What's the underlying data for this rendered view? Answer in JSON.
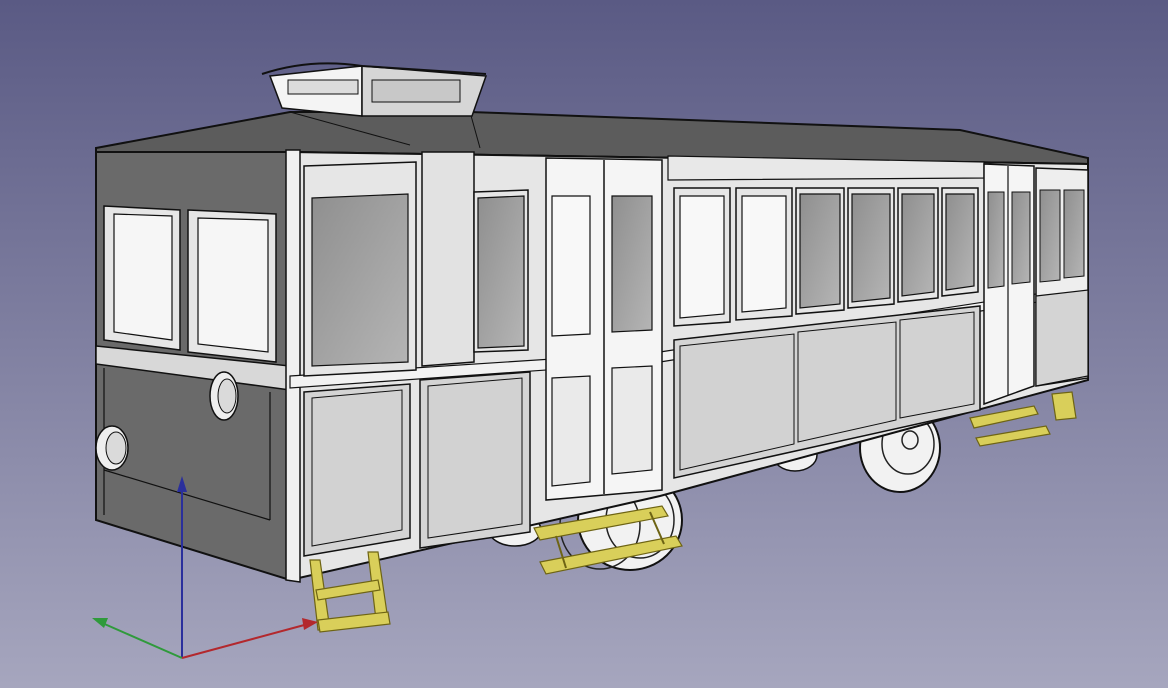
{
  "viewport": {
    "background_top": "#5a5a84",
    "background_bottom": "#a6a6be"
  },
  "model": {
    "body_fill": "#e6e6e6",
    "panel_fill": "#d4d4d4",
    "glass_fill": "#9a9a9a",
    "roof_fill": "#5c5c5c",
    "end_fill": "#6a6a6a",
    "outline": "#111111",
    "step_fill": "#d9cf5a",
    "step_outline": "#6e6414",
    "wheel_fill": "#f2f2f2"
  },
  "axis_triad": {
    "x_color": "#b3282d",
    "y_color": "#2f9a3b",
    "z_color": "#2a2f9c"
  }
}
